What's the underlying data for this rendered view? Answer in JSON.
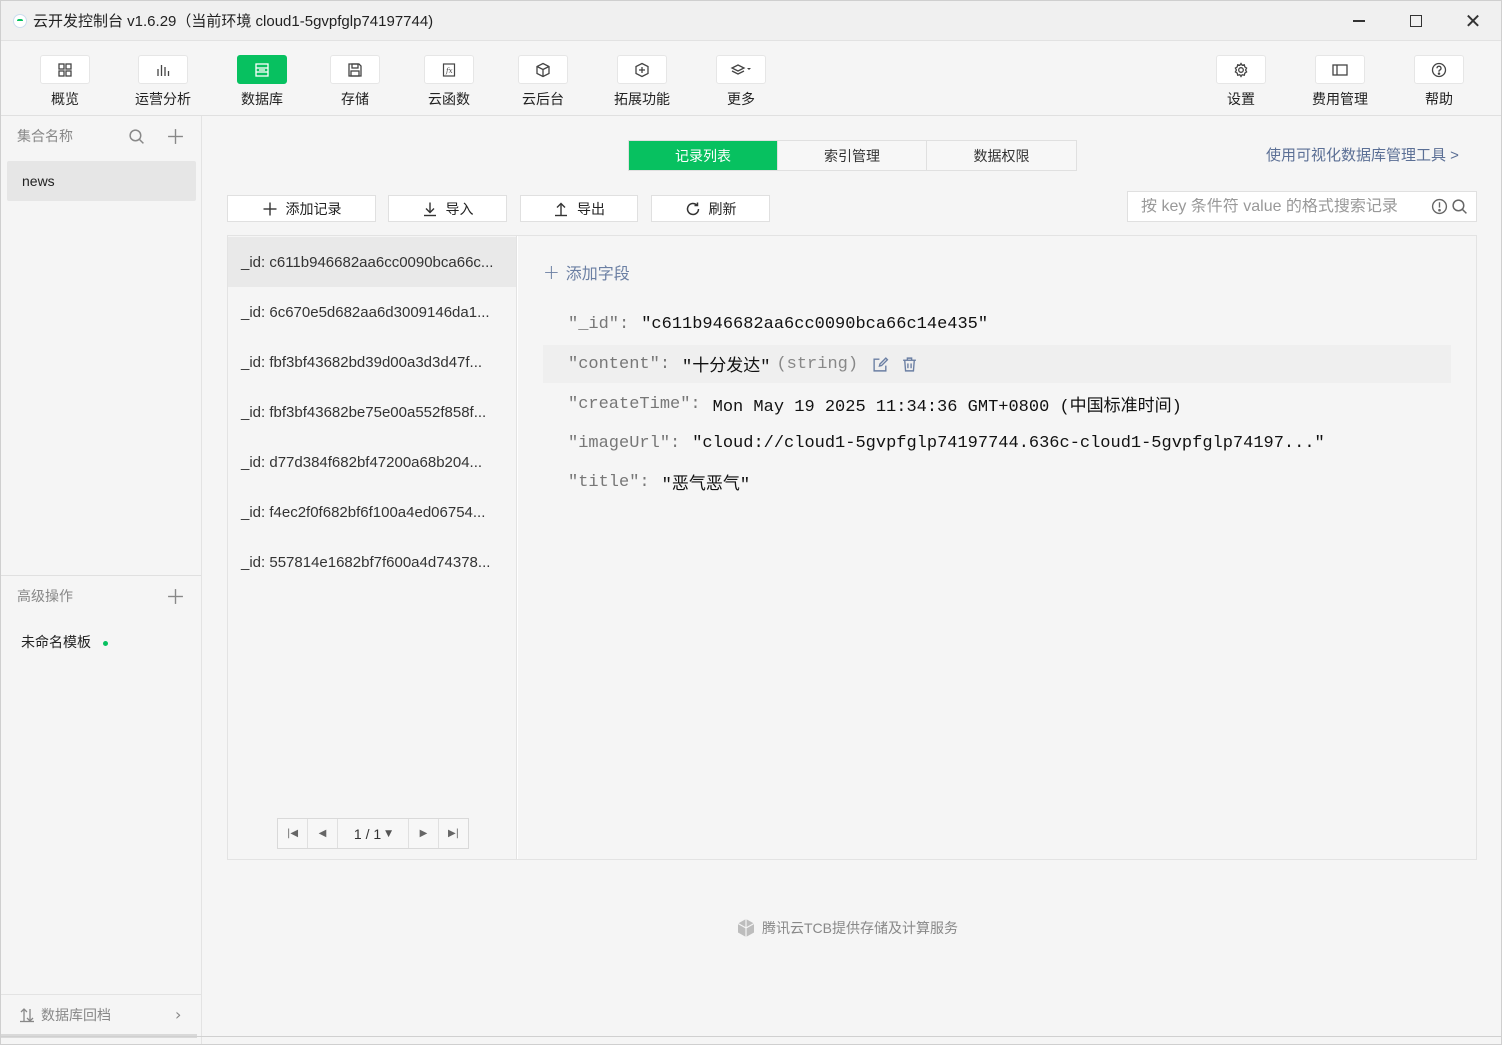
{
  "window": {
    "title": "云开发控制台 v1.6.29（当前环境 cloud1-5gvpfglp74197744)"
  },
  "toolbar": {
    "items": [
      {
        "label": "概览",
        "icon": "grid-icon"
      },
      {
        "label": "运营分析",
        "icon": "bar-chart-icon"
      },
      {
        "label": "数据库",
        "icon": "database-icon"
      },
      {
        "label": "存储",
        "icon": "save-icon"
      },
      {
        "label": "云函数",
        "icon": "function-icon"
      },
      {
        "label": "云后台",
        "icon": "cube-icon"
      },
      {
        "label": "拓展功能",
        "icon": "extension-icon"
      },
      {
        "label": "更多",
        "icon": "layers-icon"
      },
      {
        "label": "设置",
        "icon": "gear-icon"
      },
      {
        "label": "费用管理",
        "icon": "wallet-icon"
      },
      {
        "label": "帮助",
        "icon": "help-icon"
      }
    ]
  },
  "sidebar": {
    "header_label": "集合名称",
    "collections": [
      "news"
    ],
    "advanced_label": "高级操作",
    "templates": [
      {
        "label": "未命名模板"
      }
    ],
    "footer_label": "数据库回档"
  },
  "main": {
    "tabs": [
      "记录列表",
      "索引管理",
      "数据权限"
    ],
    "viz_link": "使用可视化数据库管理工具 >",
    "actions": {
      "add": "添加记录",
      "import": "导入",
      "export": "导出",
      "refresh": "刷新"
    },
    "search_placeholder": "按 key 条件符 value 的格式搜索记录",
    "records": [
      "_id: c611b946682aa6cc0090bca66c...",
      "_id: 6c670e5d682aa6d3009146da1...",
      "_id: fbf3bf43682bd39d00a3d3d47f...",
      "_id: fbf3bf43682be75e00a552f858f...",
      "_id: d77d384f682bf47200a68b204...",
      "_id: f4ec2f0f682bf6f100a4ed06754...",
      "_id: 557814e1682bf7f600a4d74378..."
    ],
    "pager": {
      "current": "1 / 1"
    },
    "detail": {
      "add_field_label": "添加字段",
      "fields": [
        {
          "key": "\"_id\"",
          "value": "\"c611b946682aa6cc0090bca66c14e435\"",
          "type": ""
        },
        {
          "key": "\"content\"",
          "value": "\"十分发达\"",
          "type": "(string)"
        },
        {
          "key": "\"createTime\"",
          "value": "Mon May 19 2025 11:34:36 GMT+0800 (中国标准时间)",
          "type": ""
        },
        {
          "key": "\"imageUrl\"",
          "value": "\"cloud://cloud1-5gvpfglp74197744.636c-cloud1-5gvpfglp74197...\"",
          "type": ""
        },
        {
          "key": "\"title\"",
          "value": "\"恶气恶气\"",
          "type": ""
        }
      ]
    },
    "footer_brand": "腾讯云TCB提供存储及计算服务"
  },
  "colors": {
    "accent": "#07c160",
    "link": "#5b6f95"
  }
}
